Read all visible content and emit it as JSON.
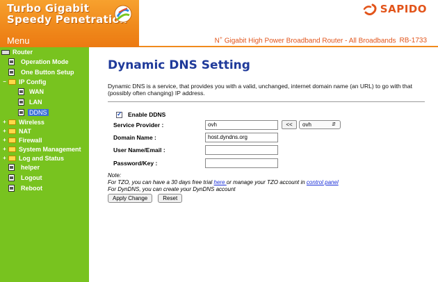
{
  "banner": {
    "title_line1": "Turbo Gigabit",
    "title_line2": "Speedy Penetration",
    "menu_label": "Menu"
  },
  "brand": {
    "name": "SAPIDO",
    "tagline_prefix": "N",
    "tagline_sup": "+",
    "tagline": "Gigabit High Power Broadband Router - All Broadbands",
    "model": "RB-1733"
  },
  "sidebar": {
    "root": "Router",
    "items": [
      {
        "label": "Operation Mode"
      },
      {
        "label": "One Button Setup"
      },
      {
        "label": "IP Config"
      },
      {
        "label": "WAN"
      },
      {
        "label": "LAN"
      },
      {
        "label": "DDNS"
      },
      {
        "label": "Wireless"
      },
      {
        "label": "NAT"
      },
      {
        "label": "Firewall"
      },
      {
        "label": "System Management"
      },
      {
        "label": "Log and Status"
      },
      {
        "label": "helper"
      },
      {
        "label": "Logout"
      },
      {
        "label": "Reboot"
      }
    ]
  },
  "main": {
    "title": "Dynamic DNS Setting",
    "description": "Dynamic DNS is a service, that provides you with a valid, unchanged, internet domain name (an URL) to go with that (possibly often changing) IP address.",
    "enable_label": "Enable DDNS",
    "enable_checked": true,
    "service_provider_label": "Service Provider :",
    "service_provider_value": "ovh",
    "copy_button": "<<",
    "provider_select": "ovh",
    "domain_label": "Domain Name :",
    "domain_value": "host.dyndns.org",
    "user_label": "User Name/Email :",
    "user_value": "",
    "password_label": "Password/Key :",
    "password_value": "",
    "note_title": "Note:",
    "note_tzo_1": "For TZO, you can have a 30 days free trial ",
    "note_tzo_link1": "here ",
    "note_tzo_2": "or manage your TZO account in ",
    "note_tzo_link2": "control panel",
    "note_dyndns": "For DynDNS, you can create your DynDNS account",
    "apply_button": "Apply Change",
    "reset_button": "Reset"
  },
  "colors": {
    "sidebar": "#78c31f",
    "banner": "#f08a1c",
    "title": "#1f3a9a",
    "brand": "#e2541a"
  }
}
